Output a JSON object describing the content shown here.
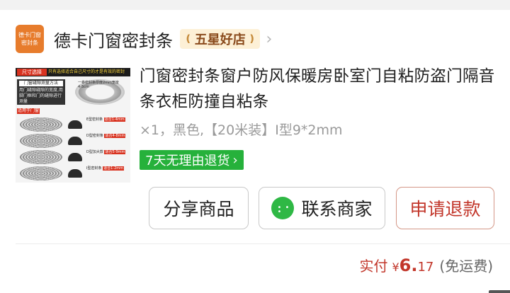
{
  "shop": {
    "logo_text": "德卡门窗密封条",
    "name": "德卡门窗密封条",
    "badge": "五星好店",
    "chevron_icon": "chevron-right-icon"
  },
  "product": {
    "image_tag": "尺寸选择",
    "image_tip": "只有选择适合自己尺寸的才是有效的密封",
    "image_measure_title": "门窗缝隙测量方法",
    "image_measure_text": "用门缝隙缝隙的宽度,用脚门框和门的缝隙进行测量",
    "image_disc_note": "一卷密封条厚度2mm宽度4-5cm",
    "image_select_tag": "适用于门窗",
    "image_specs": [
      {
        "name": "E型密封条",
        "range": "适合1-4mm"
      },
      {
        "name": "D型密封条",
        "range": "适合4-8mm"
      },
      {
        "name": "D型加大款",
        "range": "适合5-9mm"
      },
      {
        "name": "I型密封条",
        "range": "适合1-2mm"
      }
    ],
    "title": "门窗密封条窗户防风保暖房卧室门自粘防盗门隔音条衣柜防撞自粘条",
    "specs": "×1，黑色,【20米装】I型9*2mm",
    "return_label": "7天无理由退货",
    "return_icon": "chevron-right-icon"
  },
  "actions": {
    "share": "分享商品",
    "contact": "联系商家",
    "contact_icon": "wechat-chat-icon",
    "refund": "申请退款"
  },
  "price": {
    "label": "实付",
    "currency": "¥",
    "integer": "6.",
    "decimal": "17",
    "note": "(免运费)"
  },
  "colors": {
    "accent_red": "#c2362a",
    "return_green": "#26b13b",
    "badge_bg": "#fdf0d6",
    "shop_logo": "#e77c2c"
  }
}
